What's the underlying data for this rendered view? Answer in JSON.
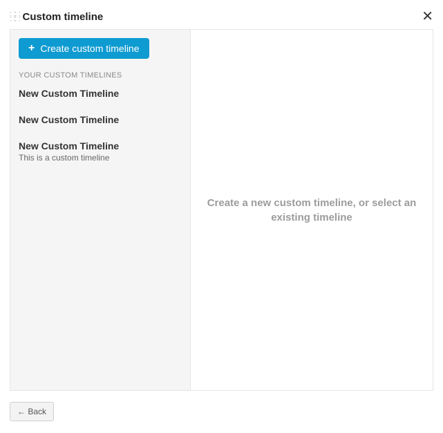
{
  "header": {
    "title": "Custom timeline"
  },
  "sidebar": {
    "create_label": "Create custom timeline",
    "section_label": "YOUR CUSTOM TIMELINES",
    "items": [
      {
        "title": "New Custom Timeline",
        "description": ""
      },
      {
        "title": "New Custom Timeline",
        "description": ""
      },
      {
        "title": "New Custom Timeline",
        "description": "This is a custom timeline"
      }
    ]
  },
  "main": {
    "placeholder": "Create a new custom timeline, or select an existing timeline"
  },
  "footer": {
    "back_label": "← Back"
  }
}
